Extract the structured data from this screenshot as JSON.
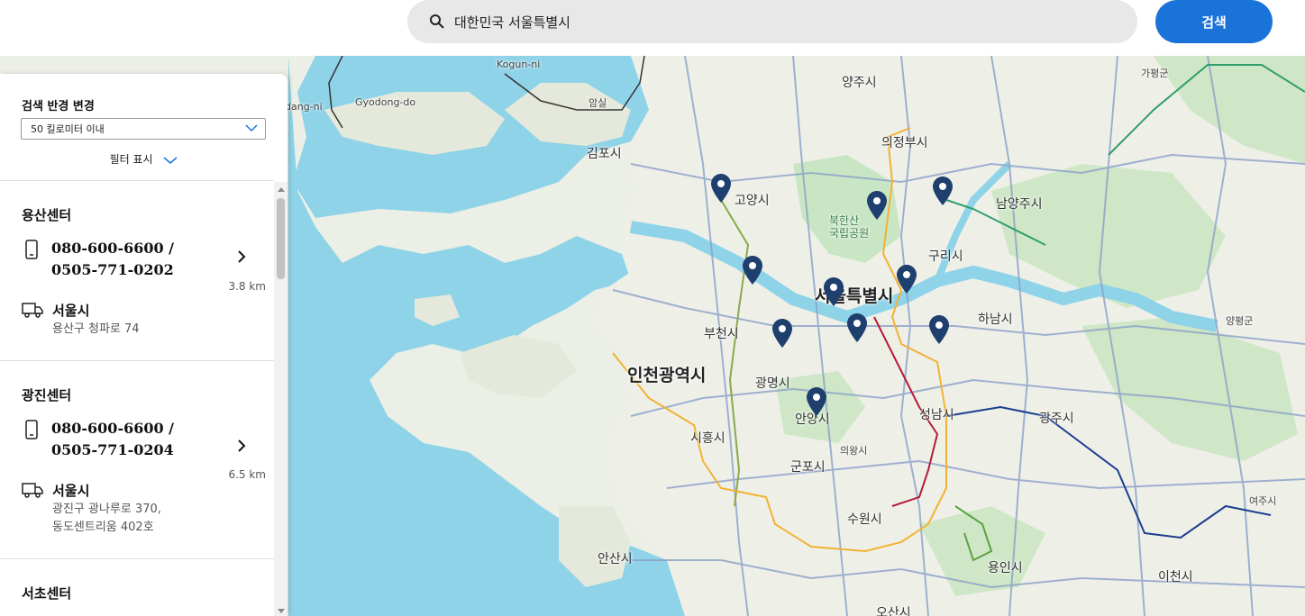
{
  "search": {
    "value": "대한민국 서울특별시",
    "button_label": "검색"
  },
  "panel": {
    "radius_title": "검색 반경 변경",
    "radius_selected": "50 킬로미터 이내",
    "filter_label": "필터 표시",
    "centers": [
      {
        "name": "용산센터",
        "phone_line1": "080-600-6600 /",
        "phone_line2": "0505-771-0202",
        "distance": "3.8 km",
        "city": "서울시",
        "address_line1": "용산구 청파로 74",
        "address_line2": ""
      },
      {
        "name": "광진센터",
        "phone_line1": "080-600-6600 /",
        "phone_line2": "0505-771-0204",
        "distance": "6.5 km",
        "city": "서울시",
        "address_line1": "광진구 광나루로 370,",
        "address_line2": "동도센트리움 402호"
      },
      {
        "name": "서초센터"
      }
    ]
  },
  "map": {
    "labels": {
      "seoul": "서울특별시",
      "incheon": "인천광역시",
      "gimpo": "김포시",
      "goyang": "고양시",
      "yangju": "양주시",
      "uijeongbu": "의정부시",
      "namyangju": "남양주시",
      "guri": "구리시",
      "hanam": "하남시",
      "bucheon": "부천시",
      "gwangmyeong": "광명시",
      "anyang": "안양시",
      "seongnam": "성남시",
      "gwangju": "광주시",
      "siheung": "시흥시",
      "gunpo": "군포시",
      "uiwang": "의왕시",
      "suwon": "수원시",
      "ansan": "안산시",
      "yongin": "용인시",
      "icheon": "이천시",
      "osan": "오산시",
      "yangpyeong": "양평군",
      "gapyeong": "가평군",
      "yeoju": "여주시",
      "amsil": "암실",
      "kogun": "Kogun-ni",
      "gyodong": "Gyodong-do",
      "dangni": "dang-ni",
      "bukhansan": "북한산\n국립공원"
    },
    "colors": {
      "water": "#8fd3e8",
      "land": "#eef0e8",
      "green": "#c9e6c4",
      "road": "#8ba0c8",
      "pin": "#1f3f6e",
      "accent": "#1a73d9"
    }
  }
}
